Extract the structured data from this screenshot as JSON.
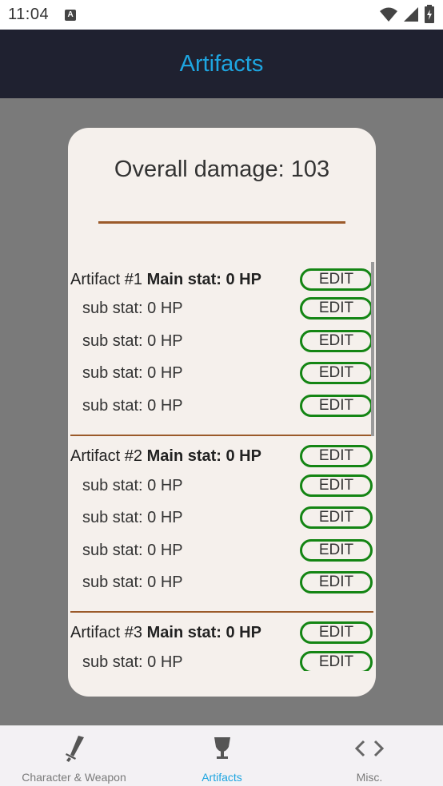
{
  "status_bar": {
    "time": "11:04",
    "notification_letter": "A"
  },
  "app_bar": {
    "title": "Artifacts"
  },
  "dialog": {
    "overall_label": "Overall damage: 103",
    "artifacts": [
      {
        "name": "Artifact #1",
        "main_stat": "Main stat: 0 HP",
        "main_edit": "EDIT",
        "subs": [
          {
            "label": "sub stat: 0 HP",
            "edit": "EDIT"
          },
          {
            "label": "sub stat: 0 HP",
            "edit": "EDIT"
          },
          {
            "label": "sub stat: 0 HP",
            "edit": "EDIT"
          },
          {
            "label": "sub stat: 0 HP",
            "edit": "EDIT"
          }
        ]
      },
      {
        "name": "Artifact #2",
        "main_stat": "Main stat: 0 HP",
        "main_edit": "EDIT",
        "subs": [
          {
            "label": "sub stat: 0 HP",
            "edit": "EDIT"
          },
          {
            "label": "sub stat: 0 HP",
            "edit": "EDIT"
          },
          {
            "label": "sub stat: 0 HP",
            "edit": "EDIT"
          },
          {
            "label": "sub stat: 0 HP",
            "edit": "EDIT"
          }
        ]
      },
      {
        "name": "Artifact #3",
        "main_stat": "Main stat: 0 HP",
        "main_edit": "EDIT",
        "subs": [
          {
            "label": "sub stat: 0 HP",
            "edit": "EDIT"
          }
        ]
      }
    ]
  },
  "bottom_nav": {
    "items": [
      {
        "label": "Character & Weapon",
        "icon": "sword-icon"
      },
      {
        "label": "Artifacts",
        "icon": "goblet-icon",
        "active": true
      },
      {
        "label": "Misc.",
        "icon": "code-icon"
      }
    ]
  },
  "colors": {
    "accent": "#1ea5e0",
    "edit_border": "#148514",
    "divider": "#9b5a2a",
    "app_bar": "#1f2130"
  }
}
